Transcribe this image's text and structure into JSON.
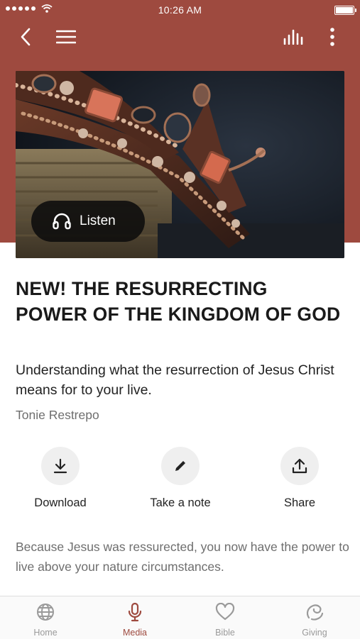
{
  "status_bar": {
    "time": "10:26 AM"
  },
  "hero": {
    "listen_label": "Listen"
  },
  "sermon": {
    "title": "NEW! THE RESURRECTING POWER OF THE KINGDOM OF GOD",
    "subtitle": "Understanding what the resurrection of Jesus Christ means for to your live.",
    "author": "Tonie Restrepo",
    "description": "Because Jesus was ressurected, you now have the power to live above your nature circumstances."
  },
  "actions": [
    {
      "label": "Download",
      "icon": "download-icon"
    },
    {
      "label": "Take a note",
      "icon": "pencil-icon"
    },
    {
      "label": "Share",
      "icon": "share-icon"
    }
  ],
  "tabs": [
    {
      "label": "Home",
      "icon": "globe-icon",
      "active": false
    },
    {
      "label": "Media",
      "icon": "microphone-icon",
      "active": true
    },
    {
      "label": "Bible",
      "icon": "heart-icon",
      "active": false
    },
    {
      "label": "Giving",
      "icon": "giving-icon",
      "active": false
    }
  ],
  "colors": {
    "header": "#9e4a3f",
    "accent": "#9e4a3f",
    "tab_inactive": "#9a9a9a"
  }
}
